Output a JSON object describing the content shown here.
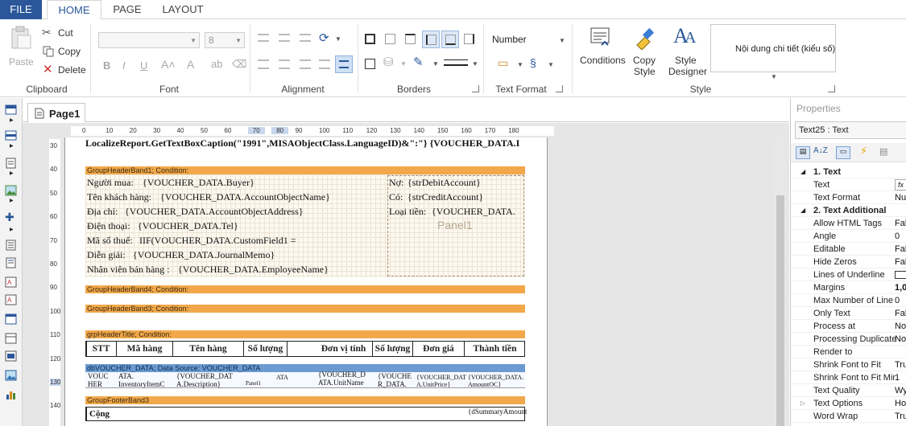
{
  "ribbon": {
    "tabs": [
      "FILE",
      "HOME",
      "PAGE",
      "LAYOUT"
    ],
    "clipboard": {
      "paste": "Paste",
      "cut": "Cut",
      "copy": "Copy",
      "delete": "Delete",
      "label": "Clipboard"
    },
    "font": {
      "size": "8",
      "label": "Font"
    },
    "alignment": {
      "label": "Alignment"
    },
    "borders": {
      "label": "Borders"
    },
    "text_format": {
      "format_value": "Number",
      "label": "Text Format"
    },
    "style": {
      "conditions": "Conditions",
      "copy_style_1": "Copy",
      "copy_style_2": "Style",
      "style_designer_1": "Style",
      "style_designer_2": "Designer",
      "style_preview": "Nội dung chi tiết (kiểu số)",
      "label": "Style"
    }
  },
  "document": {
    "tab": "Page1"
  },
  "ruler": {
    "h": [
      "0",
      "10",
      "20",
      "30",
      "40",
      "50",
      "60",
      "70",
      "80",
      "90",
      "100",
      "110",
      "120",
      "130",
      "140",
      "150",
      "160",
      "170",
      "180"
    ],
    "v": [
      "30",
      "40",
      "50",
      "60",
      "70",
      "80",
      "90",
      "100",
      "110",
      "120",
      "130",
      "140"
    ]
  },
  "report": {
    "caption_expr": "LocalizeReport.GetTextBoxCaption(\"1991\",MISAObjectClass.LanguageID)&\":\"} {VOUCHER_DATA.I",
    "band1": "GroupHeaderBand1; Condition:",
    "buyer_label": "Người mua:",
    "buyer": "{VOUCHER_DATA.Buyer}",
    "account_name_label": "Tên khách hàng:",
    "account_name": "{VOUCHER_DATA.AccountObjectName}",
    "address_label": "Địa chỉ:",
    "address": "{VOUCHER_DATA.AccountObjectAddress}",
    "tel_label": "Điện thoại:",
    "tel": "{VOUCHER_DATA.Tel}",
    "tax_label": "Mã số thuế:",
    "tax": "IIF(VOUCHER_DATA.CustomField1 =",
    "memo_label": "Diễn giải:",
    "memo": "{VOUCHER_DATA.JournalMemo}",
    "employee_label": "Nhân viên bán hàng :",
    "employee": "{VOUCHER_DATA.EmployeeName}",
    "debit_label": "Nợ:",
    "debit": "{strDebitAccount}",
    "credit_label": "Có:",
    "credit": "{strCreditAccount}",
    "currency_label": "Loại tiền:",
    "currency": "{VOUCHER_DATA.",
    "panel": "Panel1",
    "band4": "GroupHeaderBand4; Condition:",
    "band3": "GroupHeaderBand3; Condition:",
    "title_band": "grpHeaderTitle; Condition:",
    "columns": [
      "STT",
      "Mã hàng",
      "Tên hàng",
      "Số lượng",
      "Đơn vị tính",
      "Số lượng",
      "Đơn giá",
      "Thành tiền"
    ],
    "data_band": "dbVOUCHER_DATA; Data Source: VOUCHER_DATA",
    "data_cells": [
      "VOUC HER",
      "ATA. InventoryItemC",
      "{VOUCHER_DAT A.Description}",
      "Panel1",
      "ATA",
      "{VOUCHER_D ATA.UnitName",
      "{VOUCHE R_DATA.",
      "{VOUCHER_DAT A.UnitPrice}",
      "{VOUCHER_DATA. AmountOC}"
    ],
    "footer_band": "GroupFooterBand3",
    "total_label": "Cộng",
    "summary": "{dSummaryAmount"
  },
  "properties": {
    "title": "Properties",
    "selected": "Text25 : Text",
    "rows": [
      {
        "k": "1. Text",
        "v": "",
        "cat": true
      },
      {
        "k": "Text",
        "v": "fx"
      },
      {
        "k": "Text Format",
        "v": "Nu"
      },
      {
        "k": "2. Text  Additional",
        "v": "",
        "cat": true
      },
      {
        "k": "Allow HTML Tags",
        "v": "Fal"
      },
      {
        "k": "Angle",
        "v": "0"
      },
      {
        "k": "Editable",
        "v": "Fal"
      },
      {
        "k": "Hide Zeros",
        "v": "Fal"
      },
      {
        "k": "Lines of Underline",
        "v": ""
      },
      {
        "k": "Margins",
        "v": "1,0"
      },
      {
        "k": "Max Number of Line",
        "v": "0"
      },
      {
        "k": "Only Text",
        "v": "Fal"
      },
      {
        "k": "Process at",
        "v": "Nor"
      },
      {
        "k": "Processing Duplicate",
        "v": "Nor"
      },
      {
        "k": "Render to",
        "v": ""
      },
      {
        "k": "Shrink Font to Fit",
        "v": "Tru"
      },
      {
        "k": "Shrink Font to Fit Mir",
        "v": "1"
      },
      {
        "k": "Text Quality",
        "v": "Wy"
      },
      {
        "k": "Text Options",
        "v": "Ho"
      },
      {
        "k": "Word Wrap",
        "v": "Tru"
      }
    ]
  },
  "colors": {
    "accent": "#2b579a",
    "band": "#f2a84a",
    "data_band": "#6b9bd1"
  }
}
